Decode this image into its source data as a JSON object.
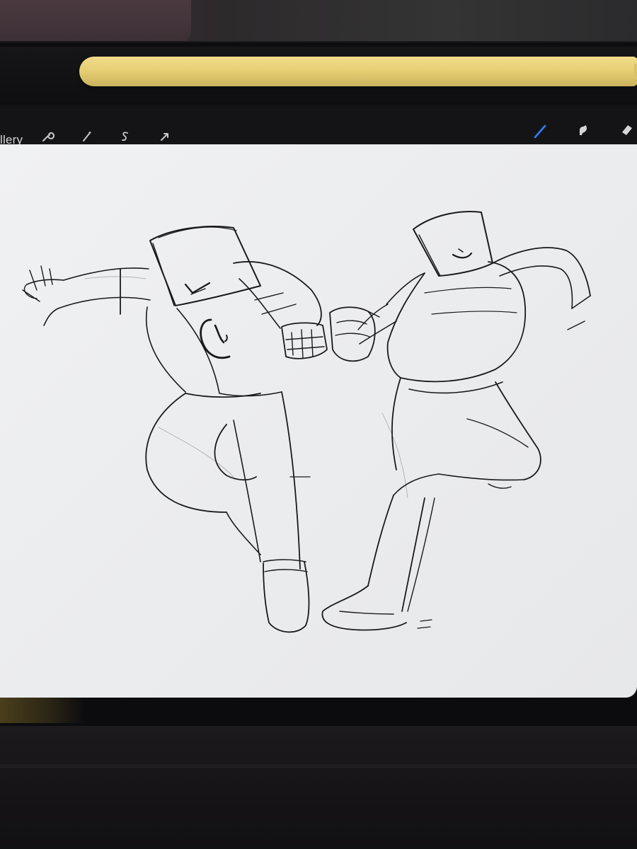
{
  "toolbar": {
    "gallery_label": "llery",
    "left_tools": [
      "wrench-icon",
      "magic-wand-icon",
      "selection-icon",
      "transform-arrow-icon"
    ],
    "right_tools": [
      "brush-icon",
      "smudge-icon",
      "eraser-icon"
    ],
    "active_tool": "brush-icon",
    "accent_color": "#2f7fff"
  },
  "canvas": {
    "background_color": "#eeeff1",
    "stroke_color": "#1a1a1a"
  },
  "pencil": {
    "color": "#e6cf74"
  }
}
